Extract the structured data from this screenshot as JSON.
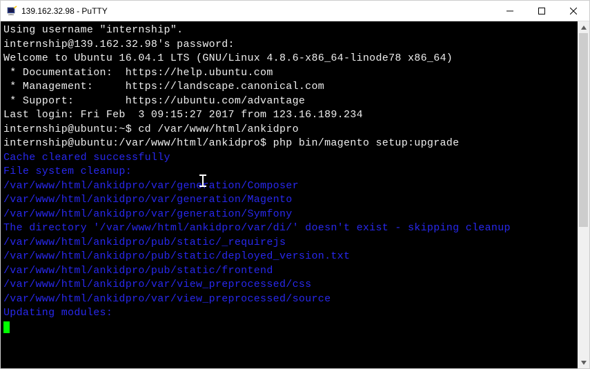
{
  "window": {
    "title": "139.162.32.98 - PuTTY"
  },
  "terminal": {
    "l1": "Using username \"internship\".",
    "l2": "internship@139.162.32.98's password:",
    "l3": "Welcome to Ubuntu 16.04.1 LTS (GNU/Linux 4.8.6-x86_64-linode78 x86_64)",
    "l4": "",
    "l5": " * Documentation:  https://help.ubuntu.com",
    "l6": " * Management:     https://landscape.canonical.com",
    "l7": " * Support:        https://ubuntu.com/advantage",
    "l8": "Last login: Fri Feb  3 09:15:27 2017 from 123.16.189.234",
    "l9_prompt": "internship@ubuntu:~$ ",
    "l9_cmd": "cd /var/www/html/ankidpro",
    "l10_prompt": "internship@ubuntu:/var/www/html/ankidpro$ ",
    "l10_cmd": "php bin/magento setup:upgrade",
    "l11": "Cache cleared successfully",
    "l12": "File system cleanup:",
    "l13": "/var/www/html/ankidpro/var/generation/Composer",
    "l14": "/var/www/html/ankidpro/var/generation/Magento",
    "l15": "/var/www/html/ankidpro/var/generation/Symfony",
    "l16": "The directory '/var/www/html/ankidpro/var/di/' doesn't exist - skipping cleanup",
    "l17": "/var/www/html/ankidpro/pub/static/_requirejs",
    "l18": "/var/www/html/ankidpro/pub/static/deployed_version.txt",
    "l19": "/var/www/html/ankidpro/pub/static/frontend",
    "l20": "/var/www/html/ankidpro/var/view_preprocessed/css",
    "l21": "/var/www/html/ankidpro/var/view_preprocessed/source",
    "l22": "Updating modules:"
  }
}
